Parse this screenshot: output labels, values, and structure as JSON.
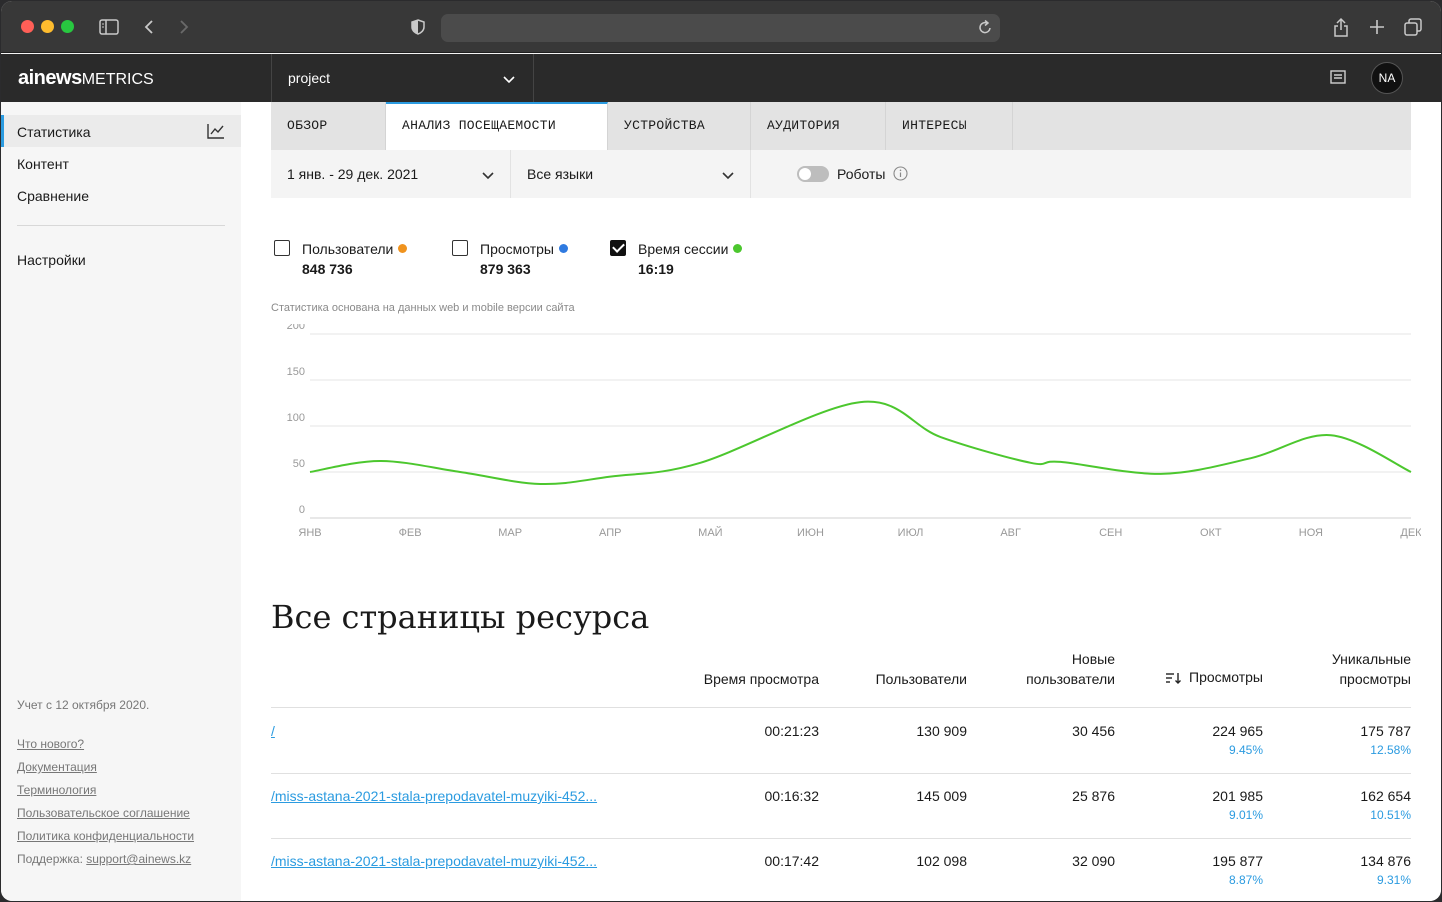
{
  "app": {
    "logo_main": "ainews",
    "logo_sub": "METRICS",
    "project": "project",
    "avatar": "NA"
  },
  "icons": {
    "sidebar_toggle": "sidebar-icon",
    "back": "chevron-left-icon",
    "forward": "chevron-right-icon",
    "shield": "shield-icon",
    "reload": "reload-icon",
    "share": "share-icon",
    "new_tab": "plus-icon",
    "tabs": "tabs-icon",
    "stats": "chart-line-icon",
    "news": "newspaper-icon",
    "info": "info-icon",
    "sort": "sort-icon"
  },
  "sidebar": {
    "items": [
      {
        "label": "Статистика"
      },
      {
        "label": "Контент"
      },
      {
        "label": "Сравнение"
      },
      {
        "label": "Настройки"
      }
    ],
    "note": "Учет с 12 октября 2020.",
    "links": [
      "Что нового?",
      "Документация",
      "Терминология",
      "Пользовательское соглашение",
      "Политика конфиденциальности"
    ],
    "support_label": "Поддержка:",
    "support_email": "support@ainews.kz"
  },
  "tabs": [
    "ОБЗОР",
    "АНАЛИЗ ПОСЕЩАЕМОСТИ",
    "УСТРОЙСТВА",
    "АУДИТОРИЯ",
    "ИНТЕРЕСЫ"
  ],
  "filters": {
    "date_range": "1 янв. - 29 дек. 2021",
    "language": "Все языки",
    "robots": "Роботы"
  },
  "metrics": [
    {
      "label": "Пользователи",
      "value": "848 736",
      "checked": false,
      "color": "#f0931e"
    },
    {
      "label": "Просмотры",
      "value": "879 363",
      "checked": false,
      "color": "#2f7ae0"
    },
    {
      "label": "Время сессии",
      "value": "16:19",
      "checked": true,
      "color": "#4cc72e"
    }
  ],
  "chart_note": "Статистика основана на данных web и mobile версии сайта",
  "chart_data": {
    "type": "line",
    "categories": [
      "ЯНВ",
      "ФЕВ",
      "МАР",
      "АПР",
      "МАЙ",
      "ИЮН",
      "ИЮЛ",
      "АВГ",
      "СЕН",
      "ОКТ",
      "НОЯ",
      "ДЕК"
    ],
    "ylim": [
      0,
      200
    ],
    "yticks": [
      0,
      50,
      100,
      150,
      200
    ],
    "series": [
      {
        "color": "#4cc72e",
        "x": [
          0,
          0.7,
          1.5,
          2.3,
          3.0,
          3.9,
          5.5,
          6.3,
          7.2,
          7.5,
          8.5,
          9.4,
          10.2,
          11.0
        ],
        "values": [
          50,
          62,
          50,
          37,
          45,
          60,
          126,
          88,
          60,
          61,
          48,
          65,
          90,
          50
        ]
      }
    ],
    "grid": true
  },
  "table": {
    "title": "Все страницы ресурса",
    "columns": [
      "Время просмотра",
      "Пользователи",
      "Новые пользователи",
      "Просмотры",
      "Уникальные просмотры"
    ],
    "rows": [
      {
        "page": "/",
        "time": "00:21:23",
        "users": "130 909",
        "new_users": "30 456",
        "views": "224 965",
        "views_pct": "9.45%",
        "unique": "175 787",
        "unique_pct": "12.58%"
      },
      {
        "page": "/miss-astana-2021-stala-prepodavatel-muzyiki-452...",
        "time": "00:16:32",
        "users": "145 009",
        "new_users": "25 876",
        "views": "201 985",
        "views_pct": "9.01%",
        "unique": "162 654",
        "unique_pct": "10.51%"
      },
      {
        "page": "/miss-astana-2021-stala-prepodavatel-muzyiki-452...",
        "time": "00:17:42",
        "users": "102 098",
        "new_users": "32 090",
        "views": "195 877",
        "views_pct": "8.87%",
        "unique": "134 876",
        "unique_pct": "9.31%"
      }
    ]
  }
}
